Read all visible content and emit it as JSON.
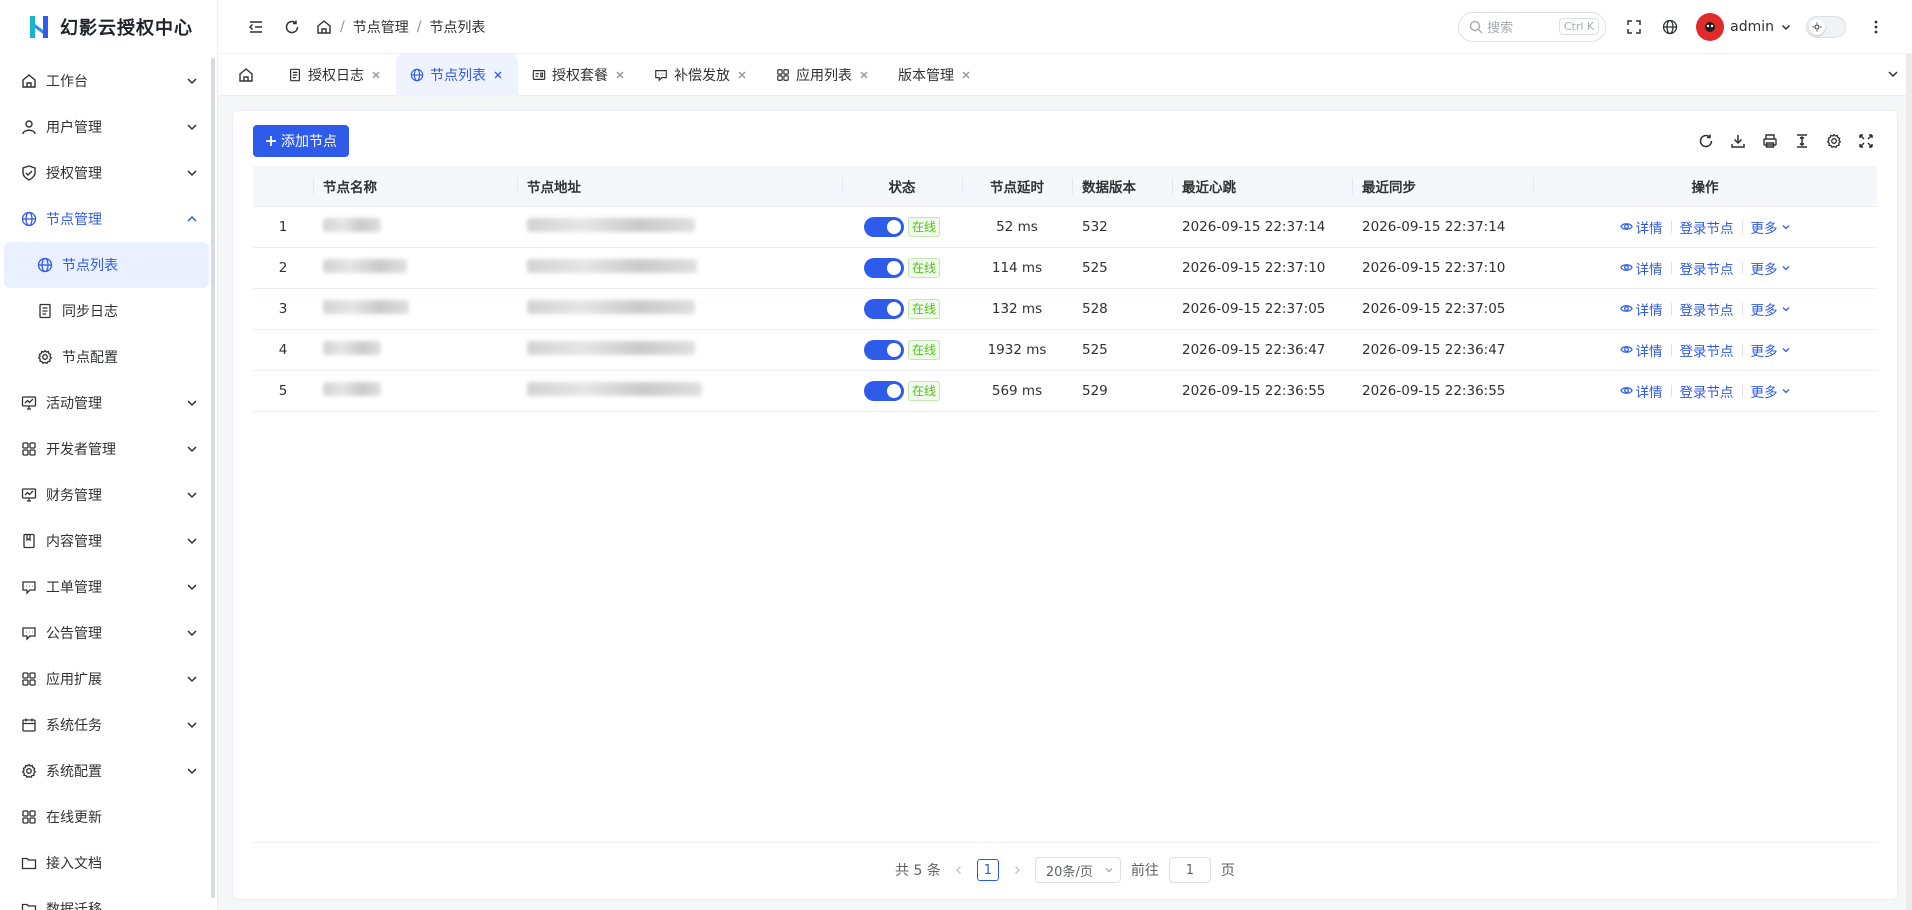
{
  "app": {
    "title": "幻影云授权中心"
  },
  "sidebar": {
    "items": [
      {
        "label": "工作台",
        "icon": "home-icon"
      },
      {
        "label": "用户管理",
        "icon": "user-icon"
      },
      {
        "label": "授权管理",
        "icon": "shield-icon"
      },
      {
        "label": "节点管理",
        "icon": "globe-icon",
        "expanded": true
      },
      {
        "label": "活动管理",
        "icon": "activity-icon"
      },
      {
        "label": "开发者管理",
        "icon": "grid-icon"
      },
      {
        "label": "财务管理",
        "icon": "finance-icon"
      },
      {
        "label": "内容管理",
        "icon": "book-icon"
      },
      {
        "label": "工单管理",
        "icon": "ticket-icon"
      },
      {
        "label": "公告管理",
        "icon": "notice-icon"
      },
      {
        "label": "应用扩展",
        "icon": "apps-icon"
      },
      {
        "label": "系统任务",
        "icon": "calendar-icon"
      },
      {
        "label": "系统配置",
        "icon": "gear-icon"
      },
      {
        "label": "在线更新",
        "icon": "update-icon"
      },
      {
        "label": "接入文档",
        "icon": "folder-icon"
      },
      {
        "label": "数据迁移",
        "icon": "folder-icon"
      }
    ],
    "submenu": [
      {
        "label": "节点列表",
        "active": true
      },
      {
        "label": "同步日志"
      },
      {
        "label": "节点配置"
      }
    ]
  },
  "topbar": {
    "breadcrumb": [
      "节点管理",
      "节点列表"
    ],
    "search_placeholder": "搜索",
    "search_shortcut": "Ctrl K",
    "username": "admin"
  },
  "tabs": [
    {
      "label": "授权日志",
      "icon": "doc-icon"
    },
    {
      "label": "节点列表",
      "icon": "globe-icon",
      "active": true
    },
    {
      "label": "授权套餐",
      "icon": "card-icon"
    },
    {
      "label": "补偿发放",
      "icon": "gift-icon"
    },
    {
      "label": "应用列表",
      "icon": "apps-icon"
    },
    {
      "label": "版本管理",
      "icon": ""
    }
  ],
  "toolbar": {
    "add_label": "添加节点"
  },
  "table": {
    "columns": [
      "",
      "节点名称",
      "节点地址",
      "状态",
      "节点延时",
      "数据版本",
      "最近心跳",
      "最近同步",
      "操作"
    ],
    "rows": [
      {
        "index": "1",
        "status": "在线",
        "latency": "52 ms",
        "version": "532",
        "heartbeat": "2026-09-15 22:37:14",
        "sync": "2026-09-15 22:37:14"
      },
      {
        "index": "2",
        "status": "在线",
        "latency": "114 ms",
        "version": "525",
        "heartbeat": "2026-09-15 22:37:10",
        "sync": "2026-09-15 22:37:10"
      },
      {
        "index": "3",
        "status": "在线",
        "latency": "132 ms",
        "version": "528",
        "heartbeat": "2026-09-15 22:37:05",
        "sync": "2026-09-15 22:37:05"
      },
      {
        "index": "4",
        "status": "在线",
        "latency": "1932 ms",
        "version": "525",
        "heartbeat": "2026-09-15 22:36:47",
        "sync": "2026-09-15 22:36:47"
      },
      {
        "index": "5",
        "status": "在线",
        "latency": "569 ms",
        "version": "529",
        "heartbeat": "2026-09-15 22:36:55",
        "sync": "2026-09-15 22:36:55"
      }
    ],
    "ops": {
      "detail": "详情",
      "login": "登录节点",
      "more": "更多"
    }
  },
  "pager": {
    "total": "共 5 条",
    "page": "1",
    "size": "20条/页",
    "goto": "前往",
    "goto_value": "1",
    "page_suffix": "页"
  },
  "colors": {
    "primary": "#2f5bea",
    "success": "#52c41a"
  }
}
